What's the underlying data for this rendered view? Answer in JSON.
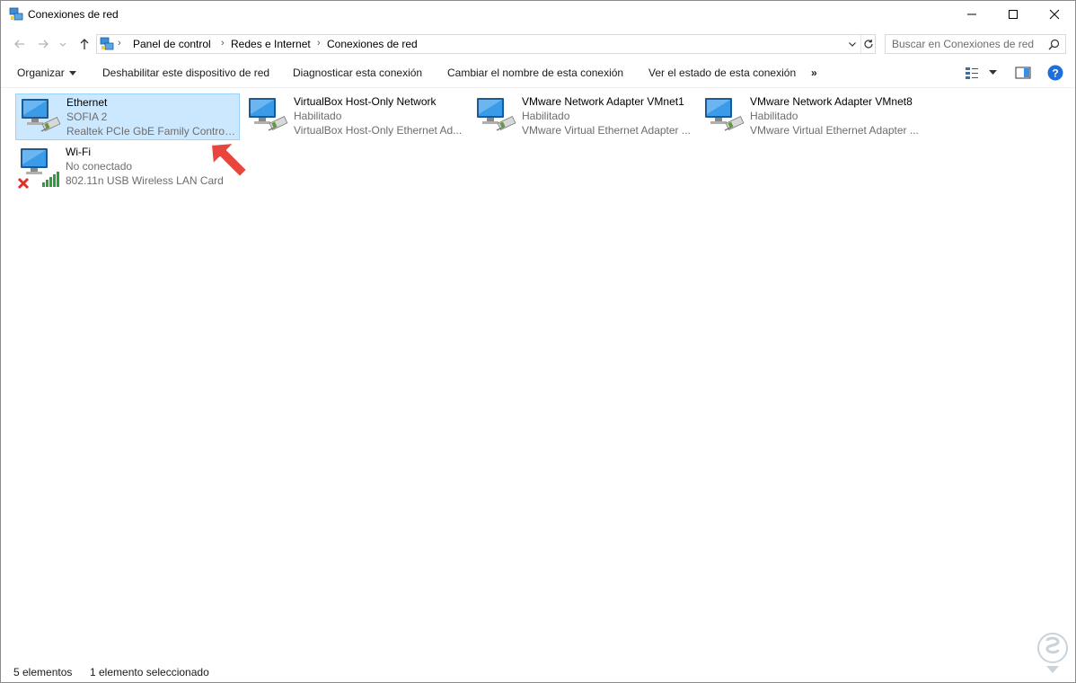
{
  "window": {
    "title": "Conexiones de red"
  },
  "breadcrumb": [
    "Panel de control",
    "Redes e Internet",
    "Conexiones de red"
  ],
  "search": {
    "placeholder": "Buscar en Conexiones de red"
  },
  "toolbar": {
    "organize_label": "Organizar",
    "commands": [
      "Deshabilitar este dispositivo de red",
      "Diagnosticar esta conexión",
      "Cambiar el nombre de esta conexión",
      "Ver el estado de esta conexión"
    ],
    "more_label": "»"
  },
  "connections": [
    {
      "name": "Ethernet",
      "status": "SOFIA 2",
      "device": "Realtek PCIe GbE Family Controller",
      "selected": true,
      "icon": "ethernet-adapter-icon"
    },
    {
      "name": "VirtualBox Host-Only Network",
      "status": "Habilitado",
      "device": "VirtualBox Host-Only Ethernet Ad...",
      "selected": false,
      "icon": "ethernet-adapter-icon"
    },
    {
      "name": "VMware Network Adapter VMnet1",
      "status": "Habilitado",
      "device": "VMware Virtual Ethernet Adapter ...",
      "selected": false,
      "icon": "ethernet-adapter-icon"
    },
    {
      "name": "VMware Network Adapter VMnet8",
      "status": "Habilitado",
      "device": "VMware Virtual Ethernet Adapter ...",
      "selected": false,
      "icon": "ethernet-adapter-icon"
    },
    {
      "name": "Wi-Fi",
      "status": "No conectado",
      "device": "802.11n USB Wireless LAN Card",
      "selected": false,
      "icon": "wifi-disconnected-icon"
    }
  ],
  "status": {
    "count": "5 elementos",
    "selection": "1 elemento seleccionado"
  },
  "colors": {
    "selection_bg": "#cce8ff",
    "selection_border": "#99d1ff",
    "help_blue": "#1e6fd9",
    "arrow_red": "#e8453c",
    "signal_green": "#2e9e3a"
  }
}
